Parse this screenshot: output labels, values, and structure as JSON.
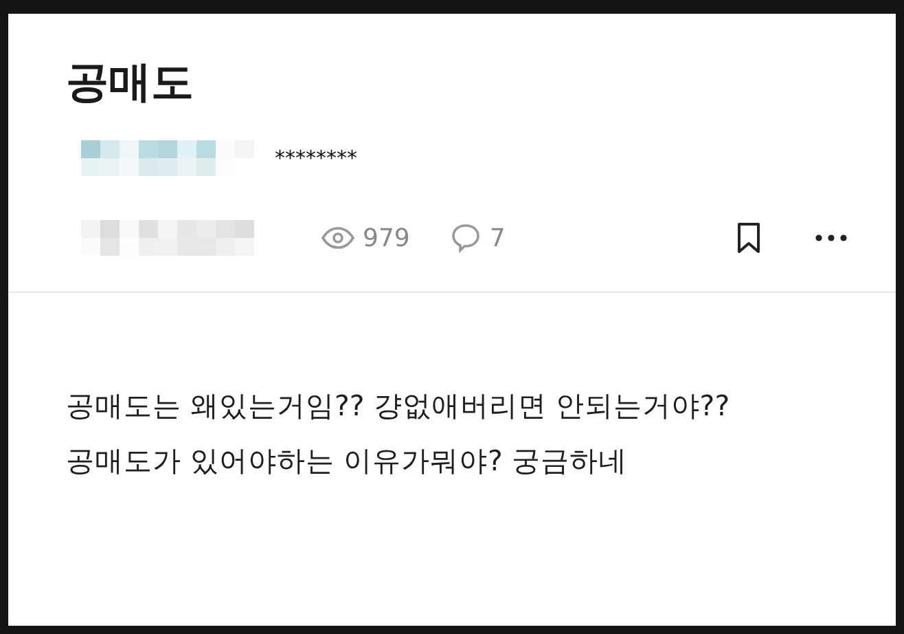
{
  "post": {
    "title": "공매도",
    "author": {
      "masked_name": "********"
    },
    "stats": {
      "views": "979",
      "comments": "7"
    },
    "bookmarked": false,
    "body": [
      "공매도는 왜있는거임?? 걍없애버리면 안되는거야??",
      "공매도가 있어야하는 이유가뭐야? 궁금하네"
    ]
  }
}
